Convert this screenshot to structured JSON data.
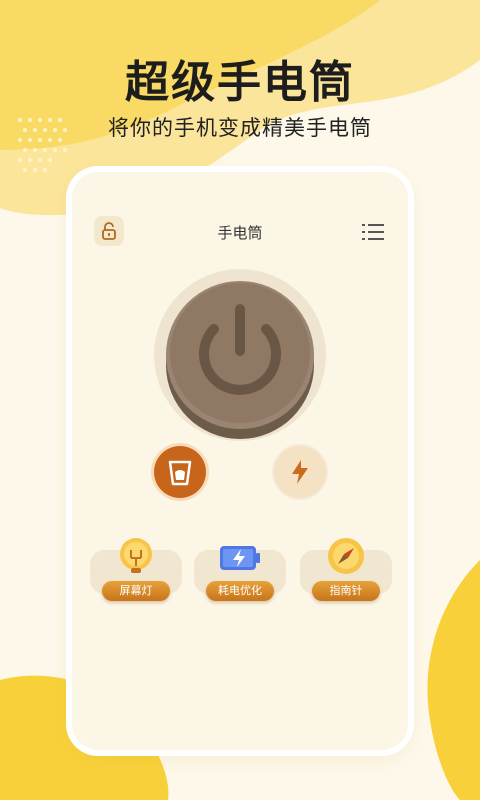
{
  "hero": {
    "title": "超级手电筒",
    "subtitle": "将你的手机变成精美手电筒"
  },
  "app": {
    "title": "手电筒",
    "lock_icon": "lock-icon",
    "menu_icon": "list-menu-icon"
  },
  "controls": {
    "power_icon": "power-icon",
    "cup_icon": "cup-icon",
    "bolt_icon": "lightning-bolt-icon"
  },
  "features": [
    {
      "label": "屏幕灯",
      "icon": "bulb-icon"
    },
    {
      "label": "耗电优化",
      "icon": "battery-icon"
    },
    {
      "label": "指南针",
      "icon": "compass-icon"
    }
  ],
  "colors": {
    "accent": "#c7661a",
    "brand_yellow": "#f8d13a",
    "background": "#fdf8ea",
    "power_button": "#8f7864"
  }
}
